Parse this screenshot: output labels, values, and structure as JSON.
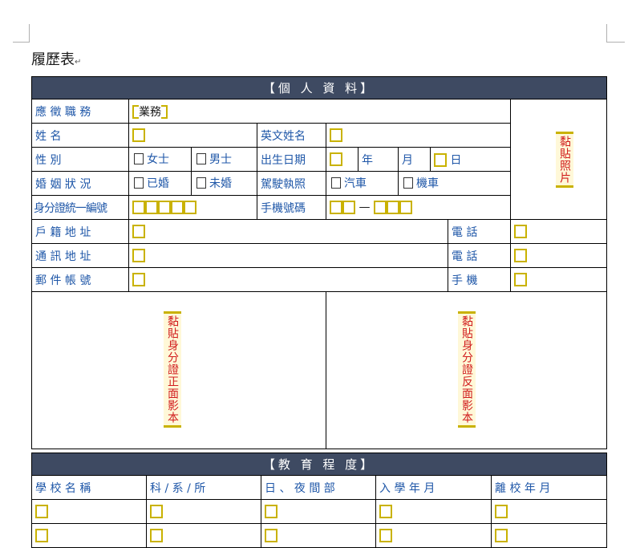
{
  "title": "履歷表",
  "section1": "【個 人 資 料】",
  "fields": {
    "job": "應 徵 職 務",
    "job_value": "業務",
    "name": "姓 名",
    "english": "英文姓名",
    "gender": "性 別",
    "female": "女士",
    "male": "男士",
    "birth": "出生日期",
    "year": "年",
    "month": "月",
    "day": "日",
    "marital": "婚 姻 狀 況",
    "married": "已婚",
    "single": "未婚",
    "license": "駕駛執照",
    "car": "汽車",
    "moto": "機車",
    "idno": "身分證統一編號",
    "mobile": "手機號碼",
    "dash": "—",
    "reg_addr": "戶 籍 地 址",
    "phone1": "電 話",
    "mail_addr": "通 訊 地 址",
    "phone2": "電 話",
    "email": "郵 件 帳 號",
    "cell": "手 機",
    "photo": "黏貼照片",
    "id_front": "黏貼身分證正面影本",
    "id_back": "黏貼身分證反面影本"
  },
  "section2": "【教 育 程 度】",
  "edu_headers": [
    "學 校 名 稱",
    "科 / 系 / 所",
    "日 、 夜 間 部",
    "入 學 年 月",
    "離 校 年 月"
  ],
  "colors": {
    "header_bg": "#3e4a62",
    "label": "#1f57a8",
    "placeholder": "#d11e1e",
    "bracket": "#c9b200"
  }
}
